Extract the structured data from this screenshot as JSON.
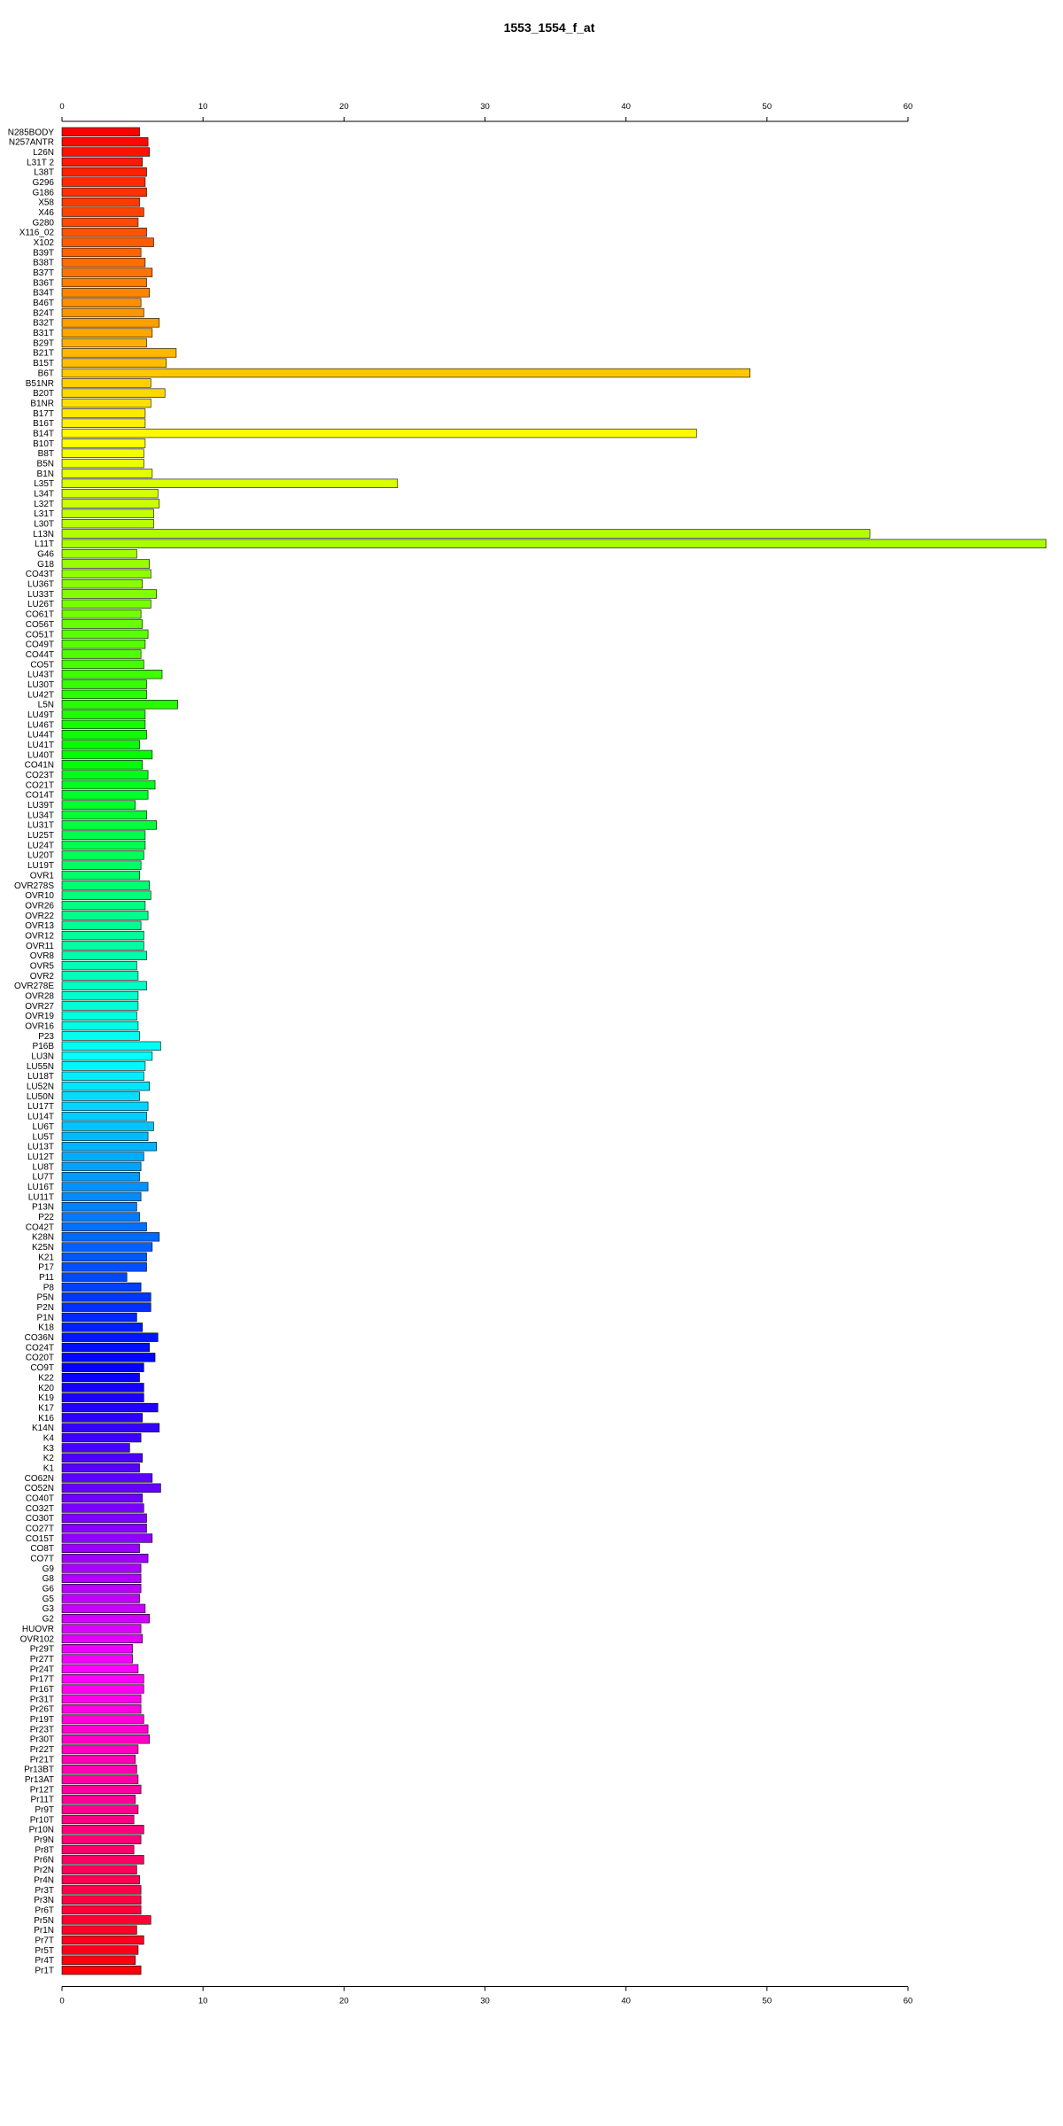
{
  "chart_data": {
    "type": "bar",
    "orientation": "horizontal",
    "title": "1553_1554_f_at",
    "xlabel": "",
    "ylabel": "",
    "xlim": [
      0,
      70
    ],
    "xticks": [
      0,
      10,
      20,
      30,
      40,
      50,
      60
    ],
    "grid": false,
    "categories": [
      "N285BODY",
      "N257ANTR",
      "L26N",
      "L31T 2",
      "L38T",
      "G296",
      "G186",
      "X58",
      "X46",
      "G280",
      "X116_02",
      "X102",
      "B39T",
      "B38T",
      "B37T",
      "B36T",
      "B34T",
      "B46T",
      "B24T",
      "B32T",
      "B31T",
      "B29T",
      "B21T",
      "B15T",
      "B6T",
      "B51NR",
      "B20T",
      "B1NR",
      "B17T",
      "B16T",
      "B14T",
      "B10T",
      "B8T",
      "B5N",
      "B1N",
      "L35T",
      "L34T",
      "L32T",
      "L31T",
      "L30T",
      "L13N",
      "L11T",
      "G46",
      "G18",
      "CO43T",
      "LU36T",
      "LU33T",
      "LU26T",
      "CO61T",
      "CO56T",
      "CO51T",
      "CO49T",
      "CO44T",
      "CO5T",
      "LU43T",
      "LU30T",
      "LU42T",
      "L5N",
      "LU49T",
      "LU46T",
      "LU44T",
      "LU41T",
      "LU40T",
      "CO41N",
      "CO23T",
      "CO21T",
      "CO14T",
      "LU39T",
      "LU34T",
      "LU31T",
      "LU25T",
      "LU24T",
      "LU20T",
      "LU19T",
      "OVR1",
      "OVR278S",
      "OVR10",
      "OVR26",
      "OVR22",
      "OVR13",
      "OVR12",
      "OVR11",
      "OVR8",
      "OVR5",
      "OVR2",
      "OVR278E",
      "OVR28",
      "OVR27",
      "OVR19",
      "OVR16",
      "P23",
      "P16B",
      "LU3N",
      "LU55N",
      "LU18T",
      "LU52N",
      "LU50N",
      "LU17T",
      "LU14T",
      "LU6T",
      "LU5T",
      "LU13T",
      "LU12T",
      "LU8T",
      "LU7T",
      "LU16T",
      "LU11T",
      "P13N",
      "P22",
      "CO42T",
      "K28N",
      "K25N",
      "K21",
      "P17",
      "P11",
      "P8",
      "P5N",
      "P2N",
      "P1N",
      "K18",
      "CO36N",
      "CO24T",
      "CO20T",
      "CO9T",
      "K22",
      "K20",
      "K19",
      "K17",
      "K16",
      "K14N",
      "K4",
      "K3",
      "K2",
      "K1",
      "CO62N",
      "CO52N",
      "CO40T",
      "CO32T",
      "CO30T",
      "CO27T",
      "CO15T",
      "CO8T",
      "CO7T",
      "G9",
      "G8",
      "G6",
      "G5",
      "G3",
      "G2",
      "HUOVR",
      "OVR102",
      "Pr29T",
      "Pr27T",
      "Pr24T",
      "Pr17T",
      "Pr16T",
      "Pr31T",
      "Pr26T",
      "Pr19T",
      "Pr23T",
      "Pr30T",
      "Pr22T",
      "Pr21T",
      "Pr13BT",
      "Pr13AT",
      "Pr12T",
      "Pr11T",
      "Pr9T",
      "Pr10T",
      "Pr10N",
      "Pr9N",
      "Pr8T",
      "Pr6N",
      "Pr2N",
      "Pr4N",
      "Pr3T",
      "Pr3N",
      "Pr6T",
      "Pr5N",
      "Pr1N",
      "Pr7T",
      "Pr5T",
      "Pr4T",
      "Pr1T"
    ],
    "values": [
      5.5,
      6.1,
      6.2,
      5.7,
      6.0,
      5.9,
      6.0,
      5.5,
      5.8,
      5.4,
      6.0,
      6.5,
      5.6,
      5.9,
      6.4,
      6.0,
      6.2,
      5.6,
      5.8,
      6.9,
      6.4,
      6.0,
      8.1,
      7.4,
      48.8,
      6.3,
      7.3,
      6.3,
      5.9,
      5.9,
      45.0,
      5.9,
      5.8,
      5.8,
      6.4,
      23.8,
      6.8,
      6.9,
      6.5,
      6.5,
      57.3,
      69.8,
      5.3,
      6.2,
      6.3,
      5.7,
      6.7,
      6.3,
      5.6,
      5.7,
      6.1,
      5.9,
      5.6,
      5.8,
      7.1,
      6.0,
      6.0,
      8.2,
      5.9,
      5.9,
      6.0,
      5.5,
      6.4,
      5.7,
      6.1,
      6.6,
      6.1,
      5.2,
      6.0,
      6.7,
      5.9,
      5.9,
      5.8,
      5.6,
      5.5,
      6.2,
      6.3,
      5.9,
      6.1,
      5.6,
      5.8,
      5.8,
      6.0,
      5.3,
      5.4,
      6.0,
      5.4,
      5.4,
      5.3,
      5.4,
      5.5,
      7.0,
      6.4,
      5.9,
      5.8,
      6.2,
      5.5,
      6.1,
      6.0,
      6.5,
      6.1,
      6.7,
      5.8,
      5.6,
      5.5,
      6.1,
      5.6,
      5.3,
      5.5,
      6.0,
      6.9,
      6.4,
      6.0,
      6.0,
      4.6,
      5.6,
      6.3,
      6.3,
      5.3,
      5.7,
      6.8,
      6.2,
      6.6,
      5.8,
      5.5,
      5.8,
      5.8,
      6.8,
      5.7,
      6.9,
      5.6,
      4.8,
      5.7,
      5.5,
      6.4,
      7.0,
      5.7,
      5.8,
      6.0,
      6.0,
      6.4,
      5.5,
      6.1,
      5.6,
      5.6,
      5.6,
      5.5,
      5.9,
      6.2,
      5.6,
      5.7,
      5.0,
      5.0,
      5.4,
      5.8,
      5.8,
      5.6,
      5.6,
      5.8,
      6.1,
      6.2,
      5.4,
      5.2,
      5.3,
      5.4,
      5.6,
      5.2,
      5.4,
      5.1,
      5.8,
      5.6,
      5.1,
      5.8,
      5.3,
      5.5,
      5.6,
      5.6,
      5.6,
      6.3,
      5.3,
      5.8,
      5.4,
      5.2,
      5.6,
      4.8
    ]
  }
}
